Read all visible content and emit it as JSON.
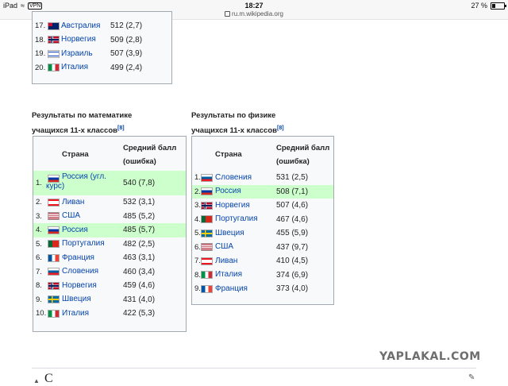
{
  "statusbar": {
    "device": "iPad",
    "network": "VPN",
    "time": "18:27",
    "url": "ru.m.wikipedia.org",
    "battery_text": "27 %",
    "battery_level": 0.27
  },
  "top_table": {
    "rows": [
      {
        "rank": "17.",
        "country": "Австралия",
        "score": "512 (2,7)",
        "flag": "australia-flag-icon"
      },
      {
        "rank": "18.",
        "country": "Норвегия",
        "score": "509 (2,8)",
        "flag": "norway-flag-icon"
      },
      {
        "rank": "19.",
        "country": "Израиль",
        "score": "507 (3,9)",
        "flag": "israel-flag-icon"
      },
      {
        "rank": "20.",
        "country": "Италия",
        "score": "499 (2,4)",
        "flag": "italy-flag-icon"
      }
    ]
  },
  "math": {
    "caption_line1": "Результаты по математике",
    "caption_line2": "учащихся 11-х классов",
    "ref": "[8]",
    "col_country": "Страна",
    "col_score_1": "Средний балл",
    "col_score_2": "(ошибка)",
    "rows": [
      {
        "rank": "1.",
        "country": "Россия (угл.",
        "country2": "курс)",
        "score": "540 (7,8)",
        "flag": "russia-flag-icon",
        "hl": true
      },
      {
        "rank": "2.",
        "country": "Ливан",
        "score": "532 (3,1)",
        "flag": "lebanon-flag-icon"
      },
      {
        "rank": "3.",
        "country": "США",
        "score": "485 (5,2)",
        "flag": "usa-flag-icon"
      },
      {
        "rank": "4.",
        "country": "Россия",
        "score": "485 (5,7)",
        "flag": "russia-flag-icon",
        "hl": true
      },
      {
        "rank": "5.",
        "country": "Португалия",
        "score": "482 (2,5)",
        "flag": "portugal-flag-icon"
      },
      {
        "rank": "6.",
        "country": "Франция",
        "score": "463 (3,1)",
        "flag": "france-flag-icon"
      },
      {
        "rank": "7.",
        "country": "Словения",
        "score": "460 (3,4)",
        "flag": "slovenia-flag-icon"
      },
      {
        "rank": "8.",
        "country": "Норвегия",
        "score": "459 (4,6)",
        "flag": "norway-flag-icon"
      },
      {
        "rank": "9.",
        "country": "Швеция",
        "score": "431 (4,0)",
        "flag": "sweden-flag-icon"
      },
      {
        "rank": "10.",
        "country": "Италия",
        "score": "422 (5,3)",
        "flag": "italy-flag-icon"
      }
    ]
  },
  "physics": {
    "caption_line1": "Результаты по физике",
    "caption_line2": "учащихся 11-х классов",
    "ref": "[8]",
    "col_country": "Страна",
    "col_score_1": "Средний балл",
    "col_score_2": "(ошибка)",
    "rows": [
      {
        "rank": "1.",
        "country": "Словения",
        "score": "531 (2,5)",
        "flag": "slovenia-flag-icon"
      },
      {
        "rank": "2.",
        "country": "Россия",
        "score": "508 (7,1)",
        "flag": "russia-flag-icon",
        "hl": true
      },
      {
        "rank": "3.",
        "country": "Норвегия",
        "score": "507 (4,6)",
        "flag": "norway-flag-icon"
      },
      {
        "rank": "4.",
        "country": "Португалия",
        "score": "467 (4,6)",
        "flag": "portugal-flag-icon"
      },
      {
        "rank": "5.",
        "country": "Швеция",
        "score": "455 (5,9)",
        "flag": "sweden-flag-icon"
      },
      {
        "rank": "6.",
        "country": "США",
        "score": "437 (9,7)",
        "flag": "usa-flag-icon"
      },
      {
        "rank": "7.",
        "country": "Ливан",
        "score": "410 (4,5)",
        "flag": "lebanon-flag-icon"
      },
      {
        "rank": "8.",
        "country": "Италия",
        "score": "374 (6,9)",
        "flag": "italy-flag-icon"
      },
      {
        "rank": "9.",
        "country": "Франция",
        "score": "373 (4,0)",
        "flag": "france-flag-icon"
      }
    ]
  },
  "watermark": "YAPLAKAL.COM",
  "next_heading": "С"
}
